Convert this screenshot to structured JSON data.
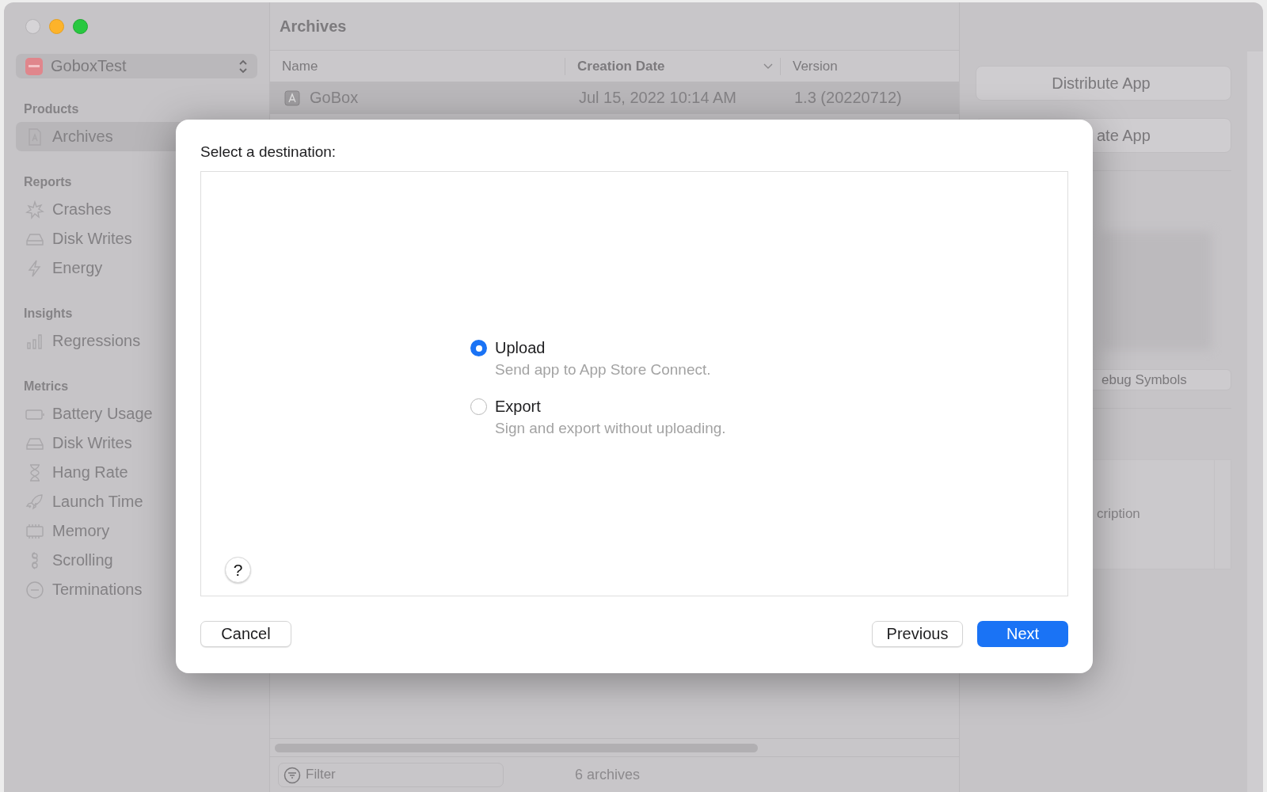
{
  "sidebar": {
    "scheme": "GoboxTest",
    "sections": [
      {
        "title": "Products",
        "items": [
          {
            "label": "Archives",
            "selected": true
          }
        ]
      },
      {
        "title": "Reports",
        "items": [
          {
            "label": "Crashes",
            "selected": false
          },
          {
            "label": "Disk Writes",
            "selected": false
          },
          {
            "label": "Energy",
            "selected": false
          }
        ]
      },
      {
        "title": "Insights",
        "items": [
          {
            "label": "Regressions",
            "selected": false
          }
        ]
      },
      {
        "title": "Metrics",
        "items": [
          {
            "label": "Battery Usage",
            "selected": false
          },
          {
            "label": "Disk Writes",
            "selected": false
          },
          {
            "label": "Hang Rate",
            "selected": false
          },
          {
            "label": "Launch Time",
            "selected": false
          },
          {
            "label": "Memory",
            "selected": false
          },
          {
            "label": "Scrolling",
            "selected": false
          },
          {
            "label": "Terminations",
            "selected": false
          }
        ]
      }
    ]
  },
  "content": {
    "title": "Archives",
    "columns": [
      {
        "label": "Name",
        "sorted": false
      },
      {
        "label": "Creation Date",
        "sorted": true
      },
      {
        "label": "Version",
        "sorted": false
      }
    ],
    "rows": [
      {
        "name": "GoBox",
        "date": "Jul 15, 2022 10:14 AM",
        "version": "1.3 (20220712)",
        "selected": true
      }
    ],
    "filter": {
      "placeholder": "Filter"
    },
    "count": "6 archives"
  },
  "inspector": {
    "buttons": [
      "Distribute App",
      "ate App"
    ],
    "debug_button": "ebug Symbols",
    "description_placeholder": "cription"
  },
  "dialog": {
    "prompt": "Select a destination:",
    "options": [
      {
        "label": "Upload",
        "detail": "Send app to App Store Connect.",
        "selected": true
      },
      {
        "label": "Export",
        "detail": "Sign and export without uploading.",
        "selected": false
      }
    ],
    "help": "?",
    "buttons": [
      {
        "label": "Cancel",
        "kind": "secondary"
      },
      {
        "label": "Previous",
        "kind": "secondary"
      },
      {
        "label": "Next",
        "kind": "primary"
      }
    ]
  }
}
